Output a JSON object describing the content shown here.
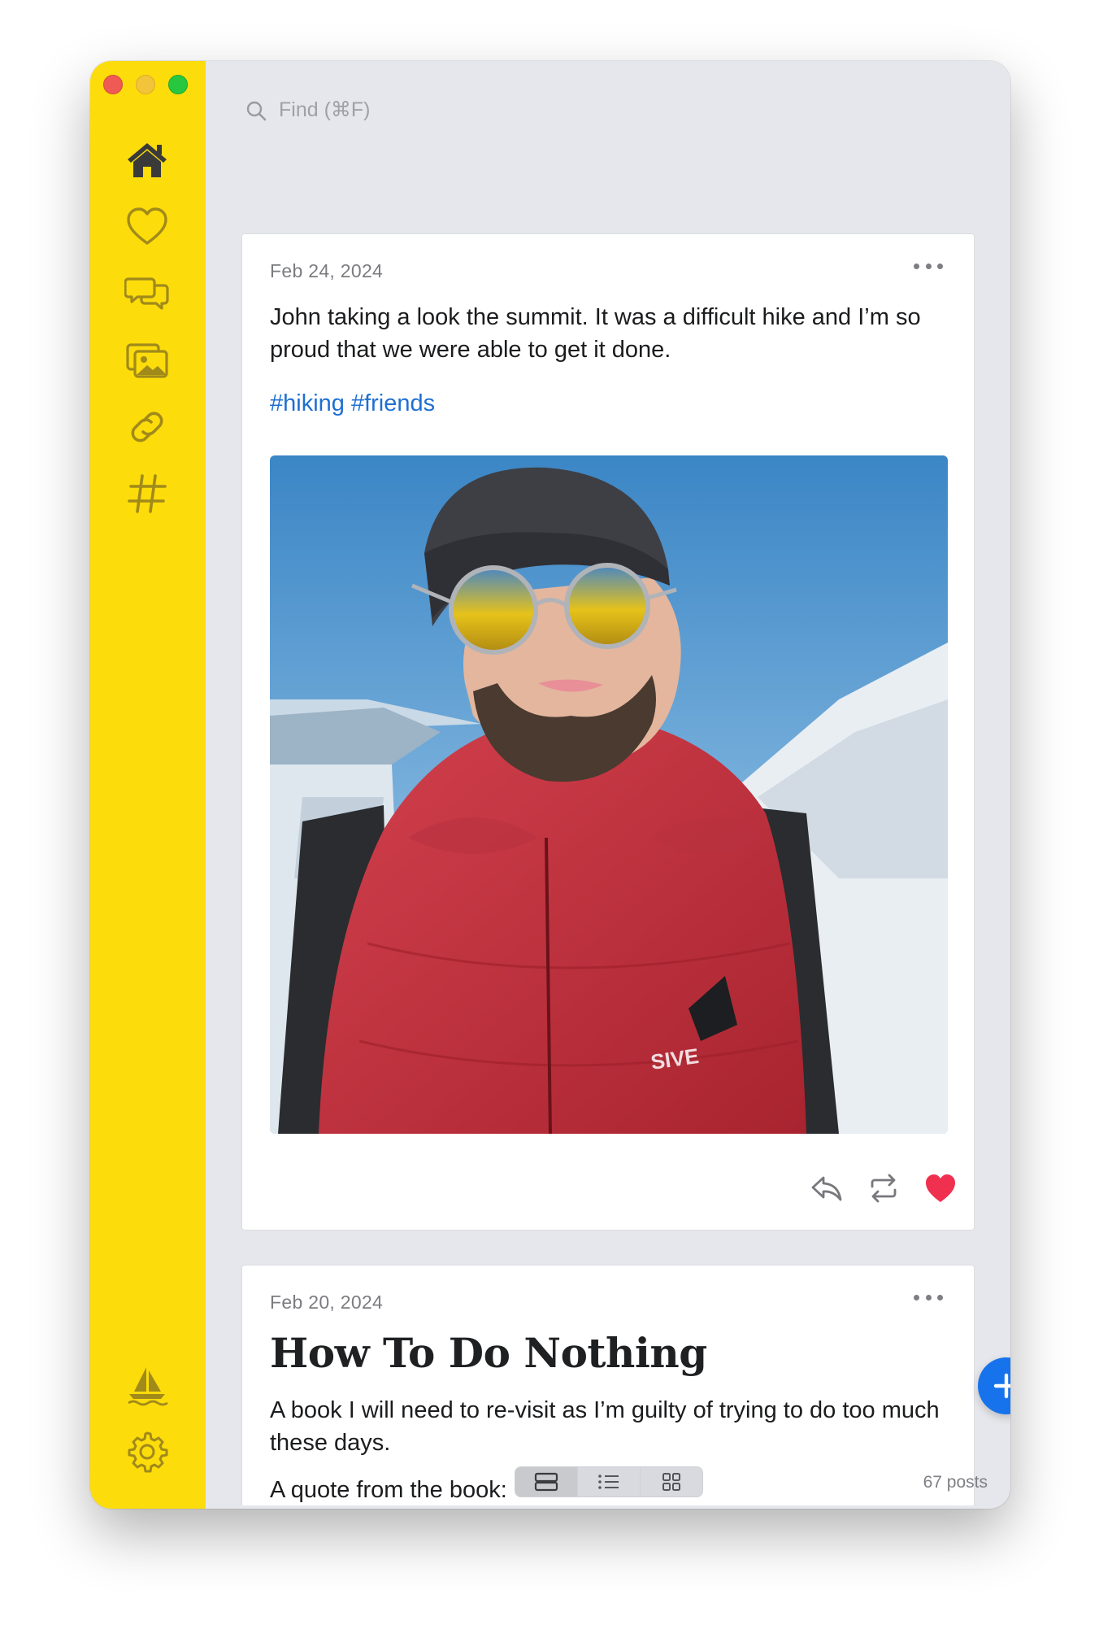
{
  "search": {
    "placeholder": "Find (⌘F)"
  },
  "sidebar": {
    "items": [
      {
        "icon": "home-icon",
        "active": true
      },
      {
        "icon": "heart-icon"
      },
      {
        "icon": "chat-bubbles-icon"
      },
      {
        "icon": "photos-icon"
      },
      {
        "icon": "link-icon"
      },
      {
        "icon": "hashtag-icon"
      }
    ],
    "bottom": [
      {
        "icon": "sailboat-icon"
      },
      {
        "icon": "gear-icon"
      }
    ]
  },
  "posts": [
    {
      "date": "Feb 24, 2024",
      "text": "John taking a look the summit. It was a difficult hike and I’m so proud that we were able to get it done.",
      "tags": [
        "#hiking",
        "#friends"
      ],
      "photo": "portrait of a bearded hiker in red puffer jacket with mirrored sunglasses and snowy mountains",
      "liked": true
    },
    {
      "date": "Feb 20, 2024",
      "title": "How To Do Nothing",
      "text": "A book I will need to re-visit as I’m guilty of trying to do too much these days.",
      "text2": "A quote from the book:"
    }
  ],
  "footer": {
    "post_count": "67 posts",
    "view_modes": [
      "cards",
      "list",
      "grid"
    ]
  },
  "colors": {
    "sidebar": "#fddc0b",
    "accent": "#1673ec",
    "tag": "#1f6fd1",
    "heart": "#f0304f"
  }
}
